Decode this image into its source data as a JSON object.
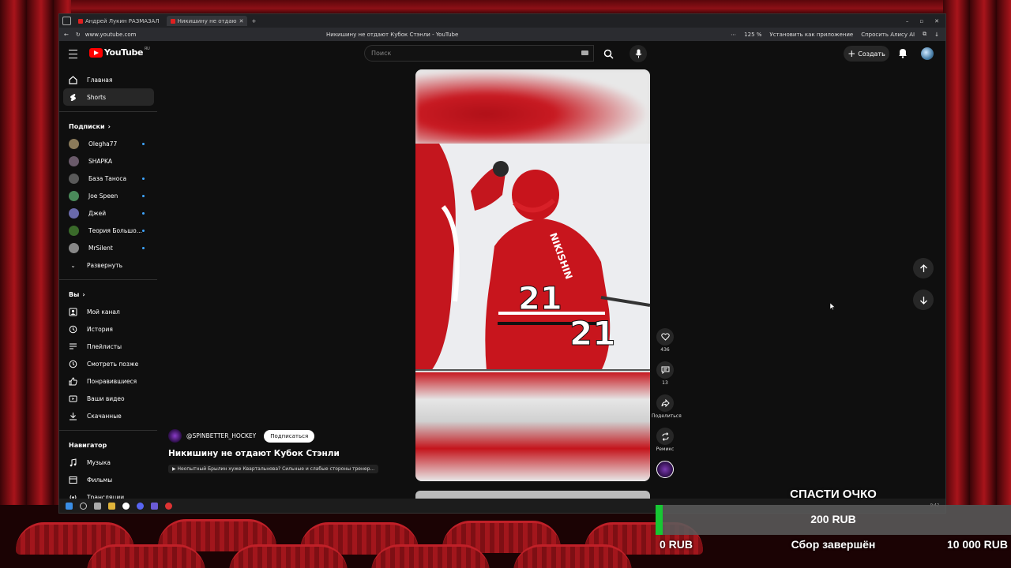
{
  "browser": {
    "tabs": [
      {
        "title": "Андрей Лукин РАЗМАЗАЛ",
        "active": false
      },
      {
        "title": "Никишину не отдаю",
        "active": true
      }
    ],
    "new_tab_label": "+",
    "url": "www.youtube.com",
    "page_title": "Никишину не отдают Кубок Стэнли - YouTube",
    "zoom": "125 %",
    "install_app": "Установить как приложение",
    "ask_alice": "Спросить Алису AI"
  },
  "header": {
    "logo": "YouTube",
    "region": "RU",
    "search_placeholder": "Поиск",
    "create_label": "Создать"
  },
  "sidebar": {
    "main": [
      {
        "label": "Главная",
        "icon": "home-icon"
      },
      {
        "label": "Shorts",
        "icon": "shorts-icon",
        "active": true
      }
    ],
    "subscriptions_title": "Подписки",
    "subscriptions": [
      {
        "label": "Olegha77",
        "color": "#8a7a5a",
        "dot": true
      },
      {
        "label": "SHAPKA",
        "color": "#6a5a6a",
        "dot": false
      },
      {
        "label": "База Таноса",
        "color": "#5a5a5a",
        "dot": true
      },
      {
        "label": "Joe Speen",
        "color": "#4a8a5a",
        "dot": true
      },
      {
        "label": "Джей",
        "color": "#6a6aaa",
        "dot": true
      },
      {
        "label": "Теория Большо...",
        "color": "#3a6a2a",
        "dot": true
      },
      {
        "label": "MrSilent",
        "color": "#888888",
        "dot": true
      }
    ],
    "expand_label": "Развернуть",
    "you_title": "Вы",
    "you": [
      {
        "label": "Мой канал",
        "icon": "channel-icon"
      },
      {
        "label": "История",
        "icon": "history-icon"
      },
      {
        "label": "Плейлисты",
        "icon": "playlist-icon"
      },
      {
        "label": "Смотреть позже",
        "icon": "clock-icon"
      },
      {
        "label": "Понравившиеся",
        "icon": "like-icon"
      },
      {
        "label": "Ваши видео",
        "icon": "video-icon"
      },
      {
        "label": "Скачанные",
        "icon": "download-icon"
      }
    ],
    "navigator_title": "Навигатор",
    "navigator": [
      {
        "label": "Музыка",
        "icon": "music-icon"
      },
      {
        "label": "Фильмы",
        "icon": "film-icon"
      },
      {
        "label": "Трансляции",
        "icon": "live-icon"
      }
    ]
  },
  "short": {
    "channel": "@SPINBETTER_HOCKEY",
    "subscribe": "Подписаться",
    "title": "Никишину не отдают Кубок Стэнли",
    "related": "Неопытный Брылин хуже Квартальнова? Сильные и слабые стороны тренер...",
    "jersey_number": "21",
    "jersey_name": "NIKISHIN",
    "likes": "436",
    "comments": "13",
    "share_label": "Поделиться",
    "remix_label": "Ремикс"
  },
  "donation": {
    "title": "СПАСТИ ОЧКО",
    "amount": "200 RUB",
    "progress": 0.02,
    "min": "0 RUB",
    "status": "Сбор завершён",
    "goal": "10 000 RUB",
    "fill_color": "#17c733"
  },
  "taskbar": {
    "time": "9:42"
  }
}
